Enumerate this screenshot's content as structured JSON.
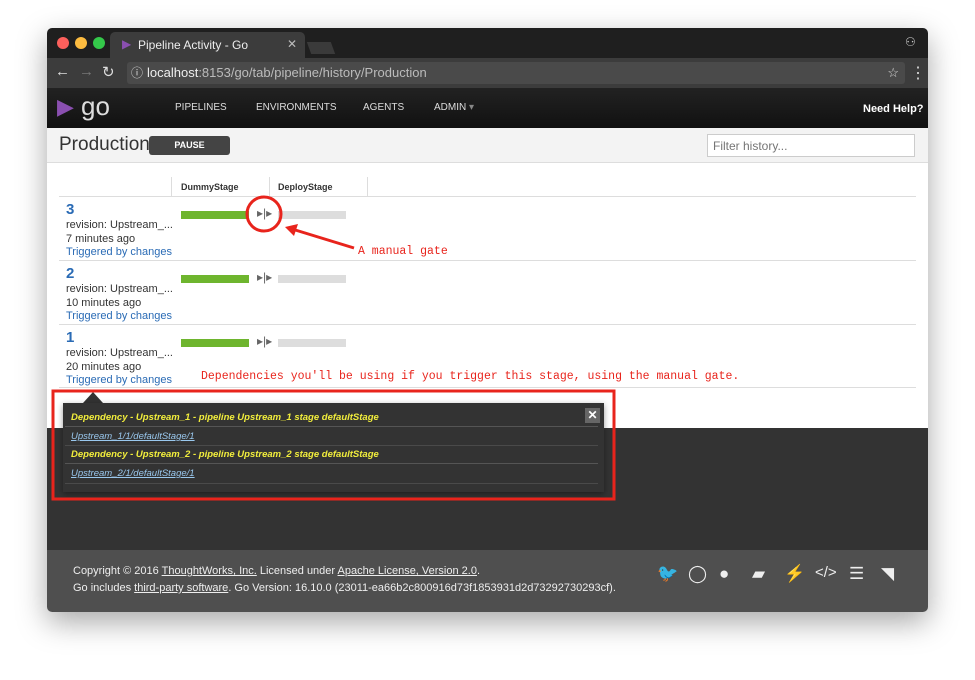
{
  "browser": {
    "tab_title": "Pipeline Activity - Go",
    "url_host": "localhost",
    "url_path": ":8153/go/tab/pipeline/history/Production"
  },
  "nav": {
    "logo": "go",
    "items": [
      "PIPELINES",
      "ENVIRONMENTS",
      "AGENTS",
      "ADMIN"
    ],
    "help": "Need Help?"
  },
  "page": {
    "title": "Production",
    "pause_label": "PAUSE",
    "filter_placeholder": "Filter history..."
  },
  "stages": [
    "DummyStage",
    "DeployStage"
  ],
  "runs": [
    {
      "counter": "3",
      "revision": "revision: Upstream_...",
      "time": "7 minutes ago",
      "trigger": "Triggered by changes",
      "stage_status": [
        "passed",
        "not-run"
      ]
    },
    {
      "counter": "2",
      "revision": "revision: Upstream_...",
      "time": "10 minutes ago",
      "trigger": "Triggered by changes",
      "stage_status": [
        "passed",
        "not-run"
      ]
    },
    {
      "counter": "1",
      "revision": "revision: Upstream_...",
      "time": "20 minutes ago",
      "trigger": "Triggered by changes",
      "stage_status": [
        "passed",
        "not-run"
      ]
    }
  ],
  "popup": {
    "deps": [
      {
        "title": "Dependency - Upstream_1 - pipeline Upstream_1 stage defaultStage",
        "link": "Upstream_1/1/defaultStage/1"
      },
      {
        "title": "Dependency - Upstream_2 - pipeline Upstream_2 stage defaultStage",
        "link": "Upstream_2/1/defaultStage/1"
      }
    ]
  },
  "annotations": {
    "gate": "A manual gate",
    "deps": "Dependencies you'll be using if you trigger this stage, using the manual gate."
  },
  "footer": {
    "c1": "Copyright © 2016 ",
    "tw": "ThoughtWorks, Inc.",
    "c2": " Licensed under ",
    "lic": "Apache License, Version 2.0",
    "c3": ".",
    "g1": "Go includes ",
    "tps": "third-party software",
    "g2": ". Go Version: 16.10.0 (23011-ea66b2c800916d73f1853931d2d73292730293cf)."
  },
  "colors": {
    "passed": "#6eb52e",
    "not_run": "#dddddd",
    "annotation": "#e8241c",
    "dependency": "#f2ee3c"
  }
}
